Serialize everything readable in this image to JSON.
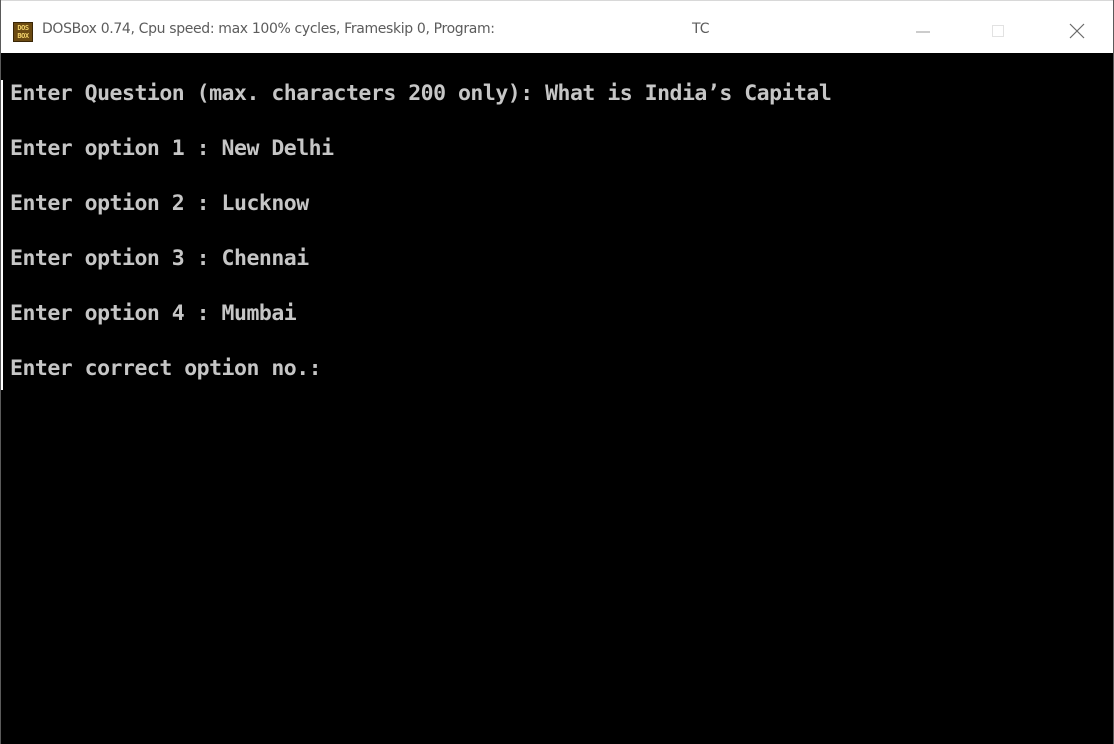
{
  "window": {
    "title": "DOSBox 0.74, Cpu speed: max 100% cycles, Frameskip  0, Program:",
    "program": "TC",
    "icon": "dosbox-app-icon",
    "icon_text_top": "DOS",
    "icon_text_bottom": "BOX"
  },
  "controls": {
    "minimize_icon": "minimize-icon",
    "maximize_icon": "maximize-icon",
    "close_icon": "close-icon"
  },
  "console": {
    "question_prompt": "Enter Question (max. characters 200 only): What is India’s Capital",
    "option1_prompt": "Enter option 1 : New Delhi",
    "option2_prompt": "Enter option 2 : Lucknow",
    "option3_prompt": "Enter option 3 : Chennai",
    "option4_prompt": "Enter option 4 : Mumbai",
    "correct_option_prompt": "Enter correct option no.:"
  },
  "colors": {
    "console_background": "#000000",
    "console_text": "#c6c6c6",
    "titlebar_background": "#ffffff",
    "title_text": "#5c5c5c"
  }
}
